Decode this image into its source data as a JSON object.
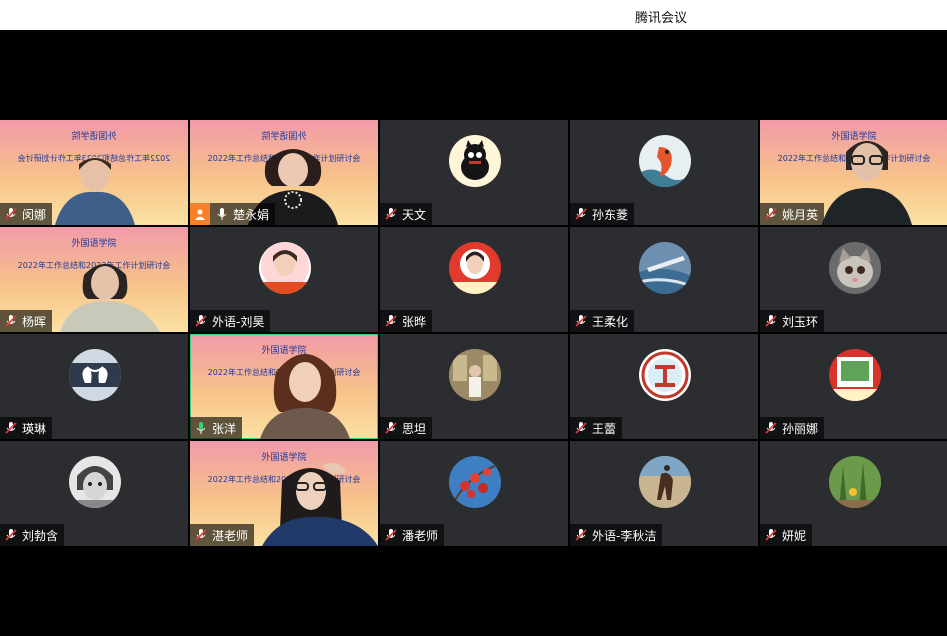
{
  "app": {
    "title": "腾讯会议"
  },
  "banner_text": {
    "line1": "外国语学院",
    "line2": "2022年工作总结和2023年工作计划研讨会"
  },
  "participants": [
    {
      "name": "闵娜",
      "mic": "muted"
    },
    {
      "name": "楚永娟",
      "mic": "unmuted",
      "host": true
    },
    {
      "name": "天文",
      "mic": "muted"
    },
    {
      "name": "孙东菱",
      "mic": "muted"
    },
    {
      "name": "姚月英",
      "mic": "muted"
    },
    {
      "name": "杨晖",
      "mic": "muted"
    },
    {
      "name": "外语-刘昊",
      "mic": "muted"
    },
    {
      "name": "张晔",
      "mic": "muted"
    },
    {
      "name": "王柔化",
      "mic": "muted"
    },
    {
      "name": "刘玉环",
      "mic": "muted"
    },
    {
      "name": "瑛琳",
      "mic": "muted"
    },
    {
      "name": "张洋",
      "mic": "speaking",
      "active": true
    },
    {
      "name": "思坦",
      "mic": "muted"
    },
    {
      "name": "王蕾",
      "mic": "muted"
    },
    {
      "name": "孙丽娜",
      "mic": "muted"
    },
    {
      "name": "刘勃含",
      "mic": "muted"
    },
    {
      "name": "湛老师",
      "mic": "muted"
    },
    {
      "name": "潘老师",
      "mic": "muted"
    },
    {
      "name": "外语-李秋洁",
      "mic": "muted"
    },
    {
      "name": "妍妮",
      "mic": "muted"
    }
  ],
  "icons": {
    "muted": "mic-muted-icon",
    "unmuted": "mic-icon",
    "speaking": "mic-speaking-icon",
    "host": "host-icon"
  },
  "colors": {
    "muted_slash": "#e03b3b",
    "speaking": "#37d17a",
    "host_badge": "#f6812a",
    "tile_bg": "#2b2d31"
  }
}
